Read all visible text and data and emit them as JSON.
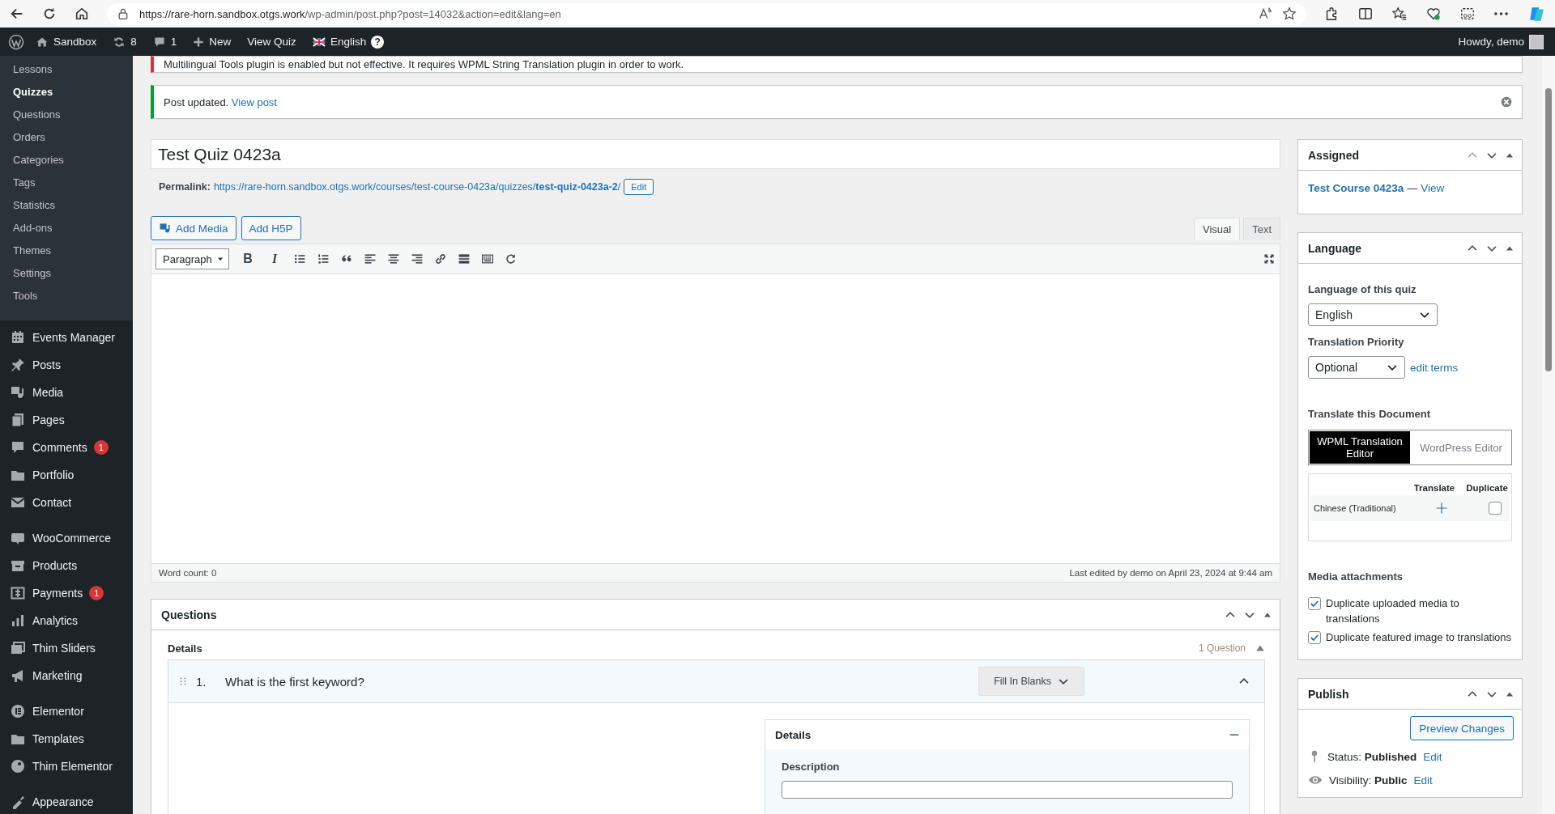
{
  "browser": {
    "url_host": "https://rare-horn.sandbox.otgs.work",
    "url_path": "/wp-admin/post.php?post=14032&action=edit&lang=en"
  },
  "admin_bar": {
    "site": "Sandbox",
    "updates": "8",
    "comments": "1",
    "new": "New",
    "view": "View Quiz",
    "language": "English",
    "help": "?",
    "greeting": "Howdy, demo"
  },
  "sidebar": {
    "submenu": [
      {
        "label": "Lessons",
        "selected": false
      },
      {
        "label": "Quizzes",
        "selected": true
      },
      {
        "label": "Questions",
        "selected": false
      },
      {
        "label": "Orders",
        "selected": false
      },
      {
        "label": "Categories",
        "selected": false
      },
      {
        "label": "Tags",
        "selected": false
      },
      {
        "label": "Statistics",
        "selected": false
      },
      {
        "label": "Add-ons",
        "selected": false
      },
      {
        "label": "Themes",
        "selected": false
      },
      {
        "label": "Settings",
        "selected": false
      },
      {
        "label": "Tools",
        "selected": false
      }
    ],
    "groups": [
      [
        {
          "label": "Events Manager"
        },
        {
          "label": "Posts"
        },
        {
          "label": "Media"
        },
        {
          "label": "Pages"
        },
        {
          "label": "Comments",
          "badge": "1"
        },
        {
          "label": "Portfolio"
        },
        {
          "label": "Contact"
        }
      ],
      [
        {
          "label": "WooCommerce"
        },
        {
          "label": "Products"
        },
        {
          "label": "Payments",
          "badge": "1"
        },
        {
          "label": "Analytics"
        },
        {
          "label": "Thim Sliders"
        },
        {
          "label": "Marketing"
        }
      ],
      [
        {
          "label": "Elementor"
        },
        {
          "label": "Templates"
        },
        {
          "label": "Thim Elementor"
        }
      ],
      [
        {
          "label": "Appearance"
        }
      ]
    ]
  },
  "notices": [
    {
      "kind": "error",
      "text": "Multilingual Tools plugin is enabled but not effective. It requires WPML String Translation plugin in order to work."
    },
    {
      "kind": "success",
      "text": "Post updated.",
      "link": "View post"
    }
  ],
  "post": {
    "title": "Test Quiz 0423a",
    "permalink_label": "Permalink:",
    "permalink": "https://rare-horn.sandbox.otgs.work/courses/test-course-0423a/quizzes/**test-quiz-0423a-2**/",
    "permalink_edit": "Edit"
  },
  "media_buttons": [
    "Add Media",
    "Add H5P"
  ],
  "editor_tabs": [
    {
      "label": "Visual",
      "selected": true
    },
    {
      "label": "Text",
      "selected": false
    }
  ],
  "format": "Paragraph",
  "toolbar": [
    {
      "kind": "bold",
      "glyph": "B"
    },
    {
      "kind": "italic",
      "glyph": "I"
    },
    {
      "kind": "bullets"
    },
    {
      "kind": "numbers"
    },
    {
      "kind": "quote"
    },
    {
      "kind": "align-left"
    },
    {
      "kind": "align-center"
    },
    {
      "kind": "align-right"
    },
    {
      "kind": "link"
    },
    {
      "kind": "more"
    },
    {
      "kind": "keyboard"
    },
    {
      "kind": "refresh"
    },
    {
      "kind": "fullscreen"
    }
  ],
  "status_bar": {
    "word_count": "Word count: 0",
    "last_edited": "Last edited by demo on April 23, 2024 at 9:44 am"
  },
  "questions": {
    "title": "Questions",
    "section": "Details",
    "count": "1 Question",
    "items": [
      {
        "number": "1.",
        "title": "What is the first keyword?",
        "type": "Fill In Blanks",
        "expanded": true
      }
    ],
    "details": {
      "title": "Details",
      "field_label": "Description"
    }
  },
  "assigned": {
    "title": "Assigned",
    "course": "Test Course 0423a",
    "separator": "—",
    "link": "View"
  },
  "language": {
    "title": "Language",
    "language_label": "Language of this quiz",
    "language_value": "English",
    "priority_label": "Translation Priority",
    "priority_value": "Optional",
    "edit_terms": "edit terms",
    "translate_label": "Translate this Document",
    "editors": [
      {
        "label": "WPML Translation Editor",
        "selected": true
      },
      {
        "label": "WordPress Editor",
        "selected": false
      }
    ],
    "table_headers": [
      "Translate",
      "Duplicate"
    ],
    "rows": [
      {
        "language": "Chinese (Traditional)",
        "duplicate": false
      }
    ],
    "media_label": "Media attachments",
    "options": [
      {
        "label": "Duplicate uploaded media to translations",
        "checked": true
      },
      {
        "label": "Duplicate featured image to translations",
        "checked": true
      }
    ]
  },
  "publish": {
    "title": "Publish",
    "preview": "Preview Changes",
    "status": {
      "text": "Status: **Published**",
      "link": "Edit"
    },
    "visibility": {
      "text": "Visibility: **Public**",
      "link": "Edit"
    }
  }
}
